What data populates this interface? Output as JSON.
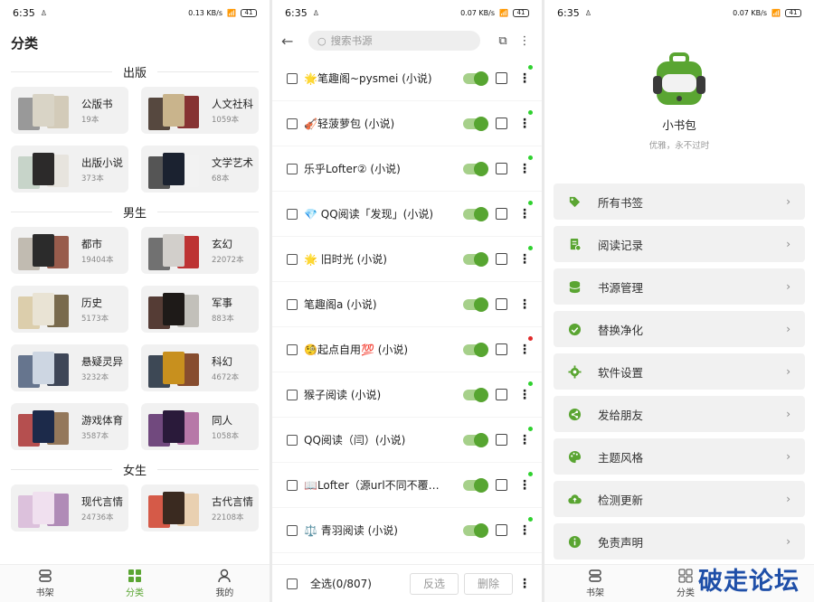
{
  "status": {
    "time": "6:35",
    "speed1": "0.13 KB/s",
    "speed2": "0.07 KB/s",
    "speed3": "0.07 KB/s",
    "battery": "41"
  },
  "categories": {
    "title": "分类",
    "sections": [
      {
        "name": "出版",
        "items": [
          {
            "name": "公版书",
            "count": "19本"
          },
          {
            "name": "人文社科",
            "count": "1059本"
          },
          {
            "name": "出版小说",
            "count": "373本"
          },
          {
            "name": "文学艺术",
            "count": "68本"
          }
        ]
      },
      {
        "name": "男生",
        "items": [
          {
            "name": "都市",
            "count": "19404本"
          },
          {
            "name": "玄幻",
            "count": "22072本"
          },
          {
            "name": "历史",
            "count": "5173本"
          },
          {
            "name": "军事",
            "count": "883本"
          },
          {
            "name": "悬疑灵异",
            "count": "3232本"
          },
          {
            "name": "科幻",
            "count": "4672本"
          },
          {
            "name": "游戏体育",
            "count": "3587本"
          },
          {
            "name": "同人",
            "count": "1058本"
          }
        ]
      },
      {
        "name": "女生",
        "items": [
          {
            "name": "现代言情",
            "count": "24736本"
          },
          {
            "name": "古代言情",
            "count": "22108本"
          }
        ]
      }
    ],
    "nav": {
      "shelf": "书架",
      "category": "分类",
      "mine": "我的"
    }
  },
  "sources": {
    "search_placeholder": "搜索书源",
    "rows": [
      {
        "name": "🌟笔趣阁~pysmei (小说)",
        "status": "green"
      },
      {
        "name": "🎻轻菠萝包 (小说)",
        "status": "green"
      },
      {
        "name": "乐乎Lofter② (小说)",
        "status": "green"
      },
      {
        "name": "💎 QQ阅读「发现」(小说)",
        "status": "green"
      },
      {
        "name": "🌟 旧时光 (小说)",
        "status": "green"
      },
      {
        "name": "笔趣阁a (小说)",
        "status": "none"
      },
      {
        "name": "🧐起点自用💯 (小说)",
        "status": "red"
      },
      {
        "name": "猴子阅读 (小说)",
        "status": "green"
      },
      {
        "name": "QQ阅读（闫）(小说)",
        "status": "green"
      },
      {
        "name": "📖Lofter（源url不同不覆…",
        "status": "green"
      },
      {
        "name": "⚖️ 青羽阅读 (小说)",
        "status": "green"
      }
    ],
    "select_all": "全选(0/807)",
    "invert": "反选",
    "delete": "删除"
  },
  "mine": {
    "app_name": "小书包",
    "slogan": "优雅，永不过时",
    "menu": [
      {
        "label": "所有书签",
        "icon": "tag-icon"
      },
      {
        "label": "阅读记录",
        "icon": "history-icon"
      },
      {
        "label": "书源管理",
        "icon": "database-icon"
      },
      {
        "label": "替换净化",
        "icon": "clean-icon"
      },
      {
        "label": "软件设置",
        "icon": "gear-icon"
      },
      {
        "label": "发给朋友",
        "icon": "share-icon"
      },
      {
        "label": "主题风格",
        "icon": "palette-icon"
      },
      {
        "label": "检测更新",
        "icon": "cloud-upload-icon"
      },
      {
        "label": "免责声明",
        "icon": "info-icon"
      }
    ],
    "nav": {
      "shelf": "书架",
      "category": "分类"
    },
    "watermark": "破走论坛"
  },
  "colors": {
    "accent": "#5aa532",
    "toggle_track": "#a6d08a",
    "watermark": "#1f4fa8"
  }
}
